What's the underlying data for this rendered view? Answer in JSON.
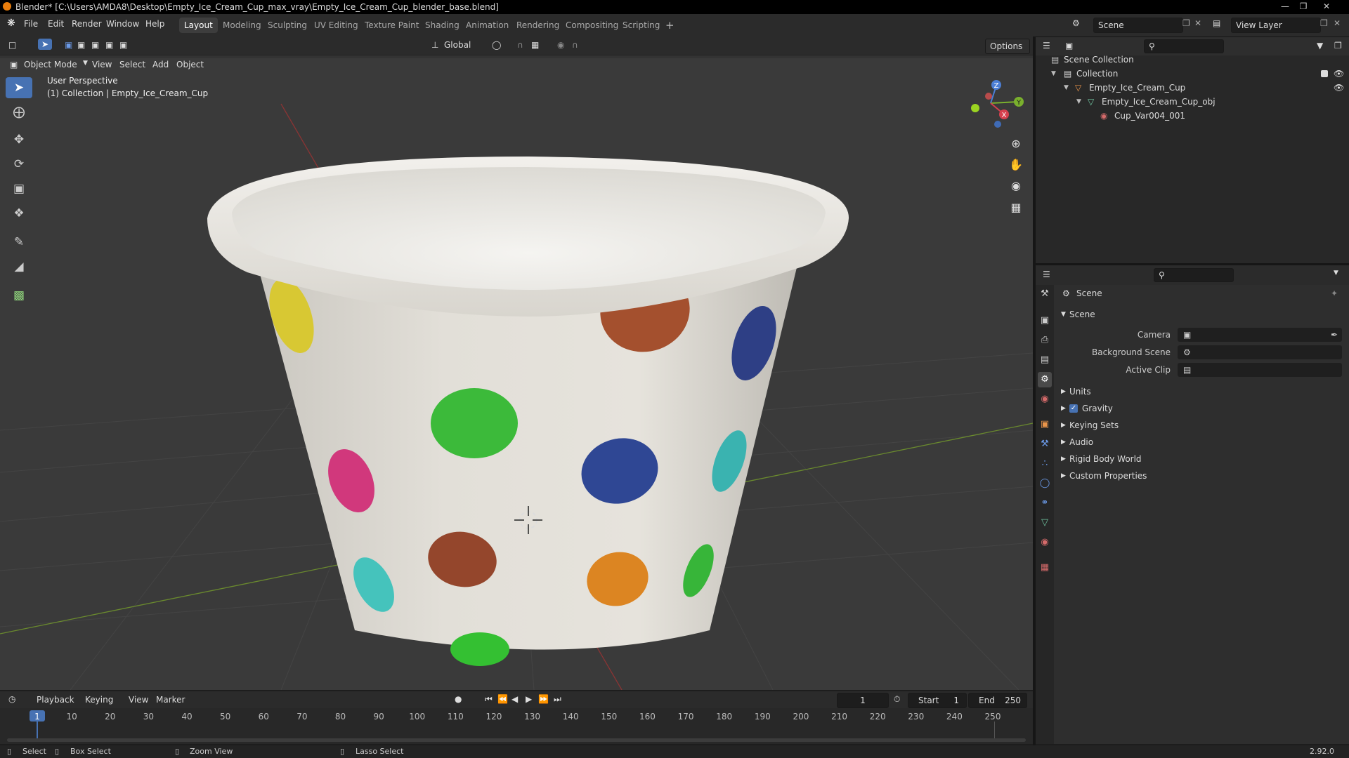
{
  "title_bar": {
    "text": "Blender* [C:\\Users\\AMDA8\\Desktop\\Empty_Ice_Cream_Cup_max_vray\\Empty_Ice_Cream_Cup_blender_base.blend]"
  },
  "menu": {
    "items": [
      "File",
      "Edit",
      "Render",
      "Window",
      "Help"
    ]
  },
  "workspaces": {
    "tabs": [
      "Layout",
      "Modeling",
      "Sculpting",
      "UV Editing",
      "Texture Paint",
      "Shading",
      "Animation",
      "Rendering",
      "Compositing",
      "Scripting"
    ],
    "active": "Layout",
    "add": "+"
  },
  "scene_selector": {
    "value": "Scene"
  },
  "view_layer": {
    "value": "View Layer"
  },
  "viewport_header": {
    "mode": "Object Mode",
    "items": [
      "View",
      "Select",
      "Add",
      "Object"
    ],
    "orientation": "Global",
    "options": "Options"
  },
  "viewport": {
    "perspective": "User Perspective",
    "collection_info": "(1) Collection | Empty_Ice_Cream_Cup",
    "gizmo": {
      "z": "Z",
      "y": "Y",
      "x": "X"
    }
  },
  "outliner": {
    "rows": [
      {
        "label": "Scene Collection",
        "icon": "scene-collection-icon"
      },
      {
        "label": "Collection",
        "icon": "collection-icon"
      },
      {
        "label": "Empty_Ice_Cream_Cup",
        "icon": "empty-object-icon"
      },
      {
        "label": "Empty_Ice_Cream_Cup_obj",
        "icon": "mesh-icon"
      },
      {
        "label": "Cup_Var004_001",
        "icon": "material-icon"
      }
    ]
  },
  "properties": {
    "breadcrumb": "Scene",
    "panel_title": "Scene",
    "fields": [
      {
        "label": "Camera"
      },
      {
        "label": "Background Scene"
      },
      {
        "label": "Active Clip"
      }
    ],
    "sections": [
      "Units",
      "Gravity",
      "Keying Sets",
      "Audio",
      "Rigid Body World",
      "Custom Properties"
    ],
    "gravity_checked": true
  },
  "timeline": {
    "menus": [
      "Playback",
      "Keying",
      "View",
      "Marker"
    ],
    "current_frame": "1",
    "start_label": "Start",
    "start_value": "1",
    "end_label": "End",
    "end_value": "250",
    "ticks": [
      "1",
      "10",
      "20",
      "30",
      "40",
      "50",
      "60",
      "70",
      "80",
      "90",
      "100",
      "110",
      "120",
      "130",
      "140",
      "150",
      "160",
      "170",
      "180",
      "190",
      "200",
      "210",
      "220",
      "230",
      "240",
      "250"
    ]
  },
  "status_bar": {
    "select": "Select",
    "box_select": "Box Select",
    "zoom_view": "Zoom View",
    "lasso_select": "Lasso Select",
    "version": "2.92.0"
  },
  "colors": {
    "accent": "#4772b3",
    "cup": "#e4e1da",
    "blender_orange": "#e87d0d"
  }
}
